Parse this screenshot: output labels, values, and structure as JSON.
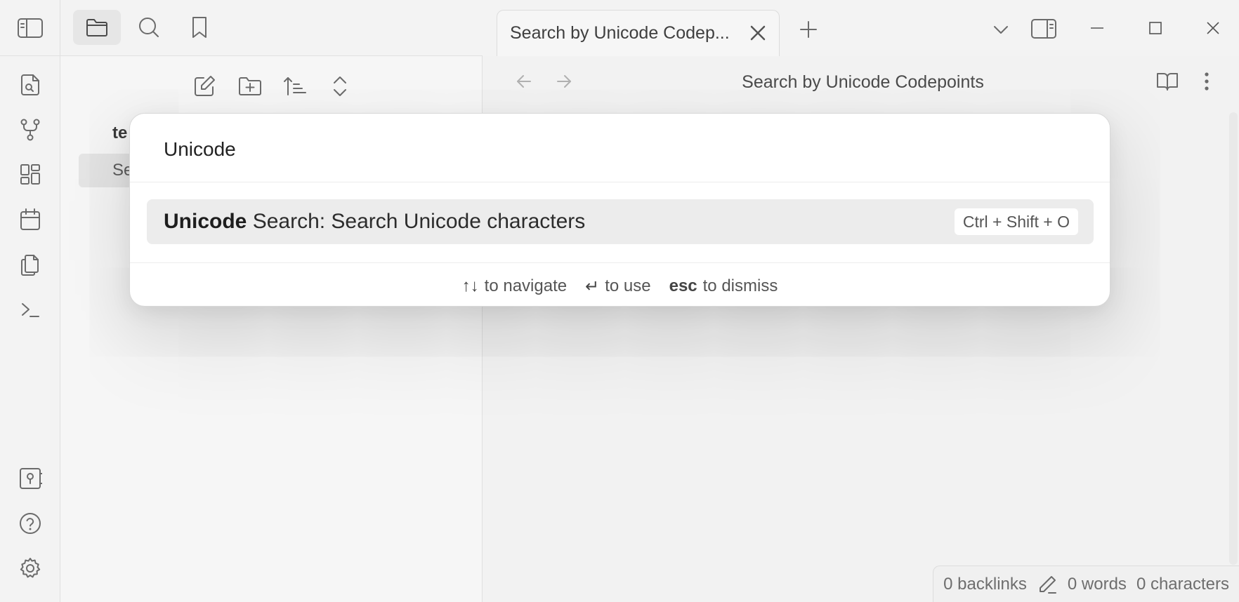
{
  "ribbon": {
    "toggle_sidebar_icon": "sidebar-left-icon",
    "items": [
      {
        "name": "open-quick-switcher",
        "icon": "file-search-icon"
      },
      {
        "name": "open-graph-view",
        "icon": "graph-icon"
      },
      {
        "name": "open-canvas",
        "icon": "layout-dashboard-icon"
      },
      {
        "name": "open-daily-note",
        "icon": "calendar-icon"
      },
      {
        "name": "insert-template",
        "icon": "copy-icon"
      },
      {
        "name": "open-command-palette",
        "icon": "terminal-icon"
      }
    ],
    "bottom": [
      {
        "name": "open-vault",
        "icon": "vault-icon"
      },
      {
        "name": "help",
        "icon": "help-icon"
      },
      {
        "name": "settings",
        "icon": "gear-icon"
      }
    ]
  },
  "sidebar": {
    "tabs": [
      {
        "name": "files",
        "icon": "folder-icon",
        "active": true
      },
      {
        "name": "search",
        "icon": "search-icon",
        "active": false
      },
      {
        "name": "bookmarks",
        "icon": "bookmark-icon",
        "active": false
      }
    ],
    "nav_actions": [
      "new-note-icon",
      "new-folder-icon",
      "sort-icon",
      "collapse-icon"
    ],
    "tree": {
      "folder_label": "te",
      "file_label": "Se"
    }
  },
  "main": {
    "tab": {
      "title": "Search by Unicode Codep..."
    },
    "view_title": "Search by Unicode Codepoints",
    "status": {
      "backlinks": "0 backlinks",
      "words": "0 words",
      "characters": "0 characters"
    }
  },
  "modal": {
    "input_value": "Unicode",
    "suggestion": {
      "match": "Unicode",
      "rest": " Search: Search Unicode characters",
      "hotkey": "Ctrl + Shift + O"
    },
    "instructions": [
      {
        "key": "↑↓",
        "text": "to navigate",
        "bold": false
      },
      {
        "key": "↵",
        "text": "to use",
        "bold": false
      },
      {
        "key": "esc",
        "text": "to dismiss",
        "bold": true
      }
    ]
  }
}
